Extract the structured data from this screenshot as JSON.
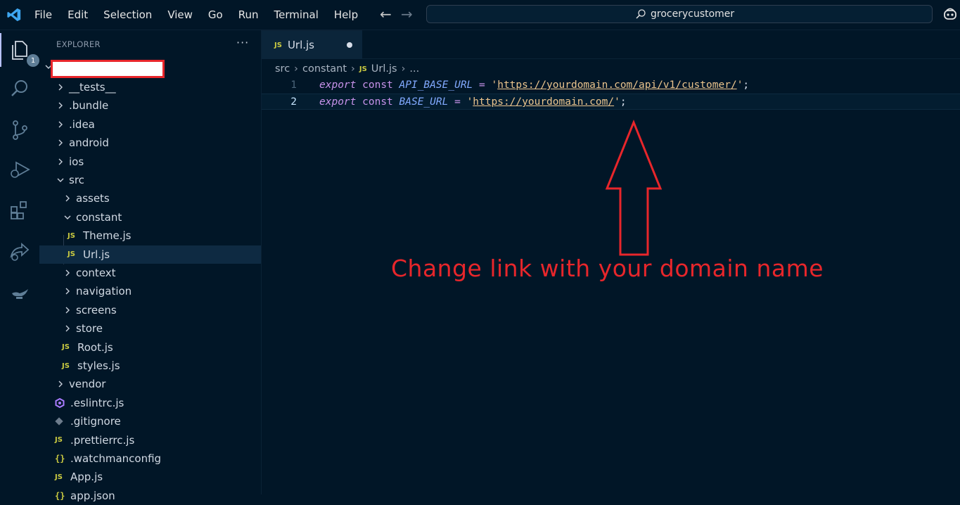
{
  "menu": [
    "File",
    "Edit",
    "Selection",
    "View",
    "Go",
    "Run",
    "Terminal",
    "Help"
  ],
  "search": {
    "text": "grocerycustomer"
  },
  "activity": {
    "explorer_badge": "1"
  },
  "explorer": {
    "header": "EXPLORER",
    "more": "···",
    "items": [
      {
        "label": "__tests__",
        "type": "folder",
        "expanded": false,
        "depth": 1
      },
      {
        "label": ".bundle",
        "type": "folder",
        "expanded": false,
        "depth": 1
      },
      {
        "label": ".idea",
        "type": "folder",
        "expanded": false,
        "depth": 1
      },
      {
        "label": "android",
        "type": "folder",
        "expanded": false,
        "depth": 1
      },
      {
        "label": "ios",
        "type": "folder",
        "expanded": false,
        "depth": 1
      },
      {
        "label": "src",
        "type": "folder",
        "expanded": true,
        "depth": 1
      },
      {
        "label": "assets",
        "type": "folder",
        "expanded": false,
        "depth": 2
      },
      {
        "label": "constant",
        "type": "folder",
        "expanded": true,
        "depth": 2
      },
      {
        "label": "Theme.js",
        "type": "js",
        "depth": 3
      },
      {
        "label": "Url.js",
        "type": "js",
        "depth": 3,
        "selected": true
      },
      {
        "label": "context",
        "type": "folder",
        "expanded": false,
        "depth": 2
      },
      {
        "label": "navigation",
        "type": "folder",
        "expanded": false,
        "depth": 2
      },
      {
        "label": "screens",
        "type": "folder",
        "expanded": false,
        "depth": 2
      },
      {
        "label": "store",
        "type": "folder",
        "expanded": false,
        "depth": 2
      },
      {
        "label": "Root.js",
        "type": "js",
        "depth": 2
      },
      {
        "label": "styles.js",
        "type": "js",
        "depth": 2
      },
      {
        "label": "vendor",
        "type": "folder",
        "expanded": false,
        "depth": 1
      },
      {
        "label": ".eslintrc.js",
        "type": "eslint",
        "depth": 1
      },
      {
        "label": ".gitignore",
        "type": "git",
        "depth": 1
      },
      {
        "label": ".prettierrc.js",
        "type": "js",
        "depth": 1
      },
      {
        "label": ".watchmanconfig",
        "type": "json",
        "depth": 1
      },
      {
        "label": "App.js",
        "type": "js",
        "depth": 1
      },
      {
        "label": "app.json",
        "type": "json",
        "depth": 1
      }
    ]
  },
  "tab": {
    "icon": "JS",
    "label": "Url.js"
  },
  "breadcrumb": {
    "parts": [
      "src",
      "constant",
      "Url.js",
      "..."
    ]
  },
  "editor": {
    "lines": [
      {
        "num": "1",
        "keyword": "export",
        "decl": "const",
        "name": "API_BASE_URL",
        "op": "=",
        "url": "https://yourdomain.com/api/v1/customer/"
      },
      {
        "num": "2",
        "keyword": "export",
        "decl": "const",
        "name": "BASE_URL",
        "op": "=",
        "url": "https://yourdomain.com/"
      }
    ]
  },
  "annotation": {
    "text": "Change link with your domain name"
  },
  "colors": {
    "background": "#011627",
    "annotation": "#e8262b",
    "selected_row": "#0e2a42"
  }
}
